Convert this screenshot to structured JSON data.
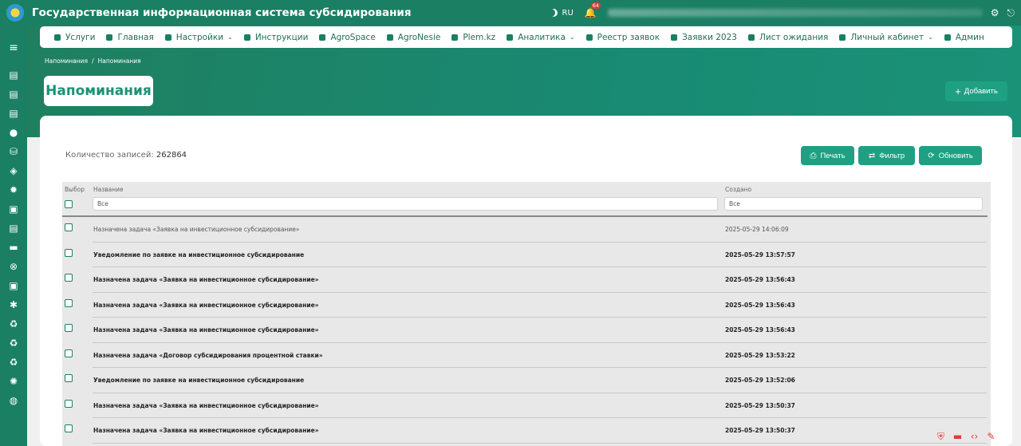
{
  "app": {
    "title": "Государственная информационная система субсидирования",
    "lang": "RU",
    "notifications": "64"
  },
  "nav": [
    {
      "label": "Услуги",
      "dropdown": false
    },
    {
      "label": "Главная",
      "dropdown": false
    },
    {
      "label": "Настройки",
      "dropdown": true
    },
    {
      "label": "Инструкции",
      "dropdown": false
    },
    {
      "label": "AgroSpace",
      "dropdown": false
    },
    {
      "label": "AgroNesie",
      "dropdown": false
    },
    {
      "label": "Plem.kz",
      "dropdown": false
    },
    {
      "label": "Аналитика",
      "dropdown": true
    },
    {
      "label": "Реестр заявок",
      "dropdown": false
    },
    {
      "label": "Заявки 2023",
      "dropdown": false
    },
    {
      "label": "Лист ожидания",
      "dropdown": false
    },
    {
      "label": "Личный кабинет",
      "dropdown": true
    },
    {
      "label": "Админ",
      "dropdown": false
    }
  ],
  "breadcrumb": {
    "home": "Напоминания",
    "separator": "/",
    "current": "Напоминания"
  },
  "page": {
    "title": "Напоминания",
    "add_label": "Добавить"
  },
  "records": {
    "label": "Количество записей:",
    "count": "262864"
  },
  "actions": {
    "print": "Печать",
    "filter": "Фильтр",
    "refresh": "Обновить"
  },
  "table": {
    "columns": {
      "select": "Выбор",
      "name": "Название",
      "created": "Создано"
    },
    "filter_placeholder": "Все",
    "rows": [
      {
        "name": "Назначена задача «Заявка на инвестиционное субсидирование»",
        "created": "2025-05-29 14:06:09",
        "read": true
      },
      {
        "name": "Уведомление по заявке на инвестиционное субсидирование",
        "created": "2025-05-29 13:57:57",
        "read": false
      },
      {
        "name": "Назначена задача «Заявка на инвестиционное субсидирование»",
        "created": "2025-05-29 13:56:43",
        "read": false
      },
      {
        "name": "Назначена задача «Заявка на инвестиционное субсидирование»",
        "created": "2025-05-29 13:56:43",
        "read": false
      },
      {
        "name": "Назначена задача «Заявка на инвестиционное субсидирование»",
        "created": "2025-05-29 13:56:43",
        "read": false
      },
      {
        "name": "Назначена задача «Договор субсидирования процентной ставки»",
        "created": "2025-05-29 13:53:22",
        "read": false
      },
      {
        "name": "Уведомление по заявке на инвестиционное субсидирование",
        "created": "2025-05-29 13:52:06",
        "read": false
      },
      {
        "name": "Назначена задача «Заявка на инвестиционное субсидирование»",
        "created": "2025-05-29 13:50:37",
        "read": false
      },
      {
        "name": "Назначена задача «Заявка на инвестиционное субсидирование»",
        "created": "2025-05-29 13:50:37",
        "read": false
      }
    ]
  },
  "colors": {
    "primary": "#1a7f63",
    "accent": "#1fa083",
    "badge": "#e53935"
  }
}
